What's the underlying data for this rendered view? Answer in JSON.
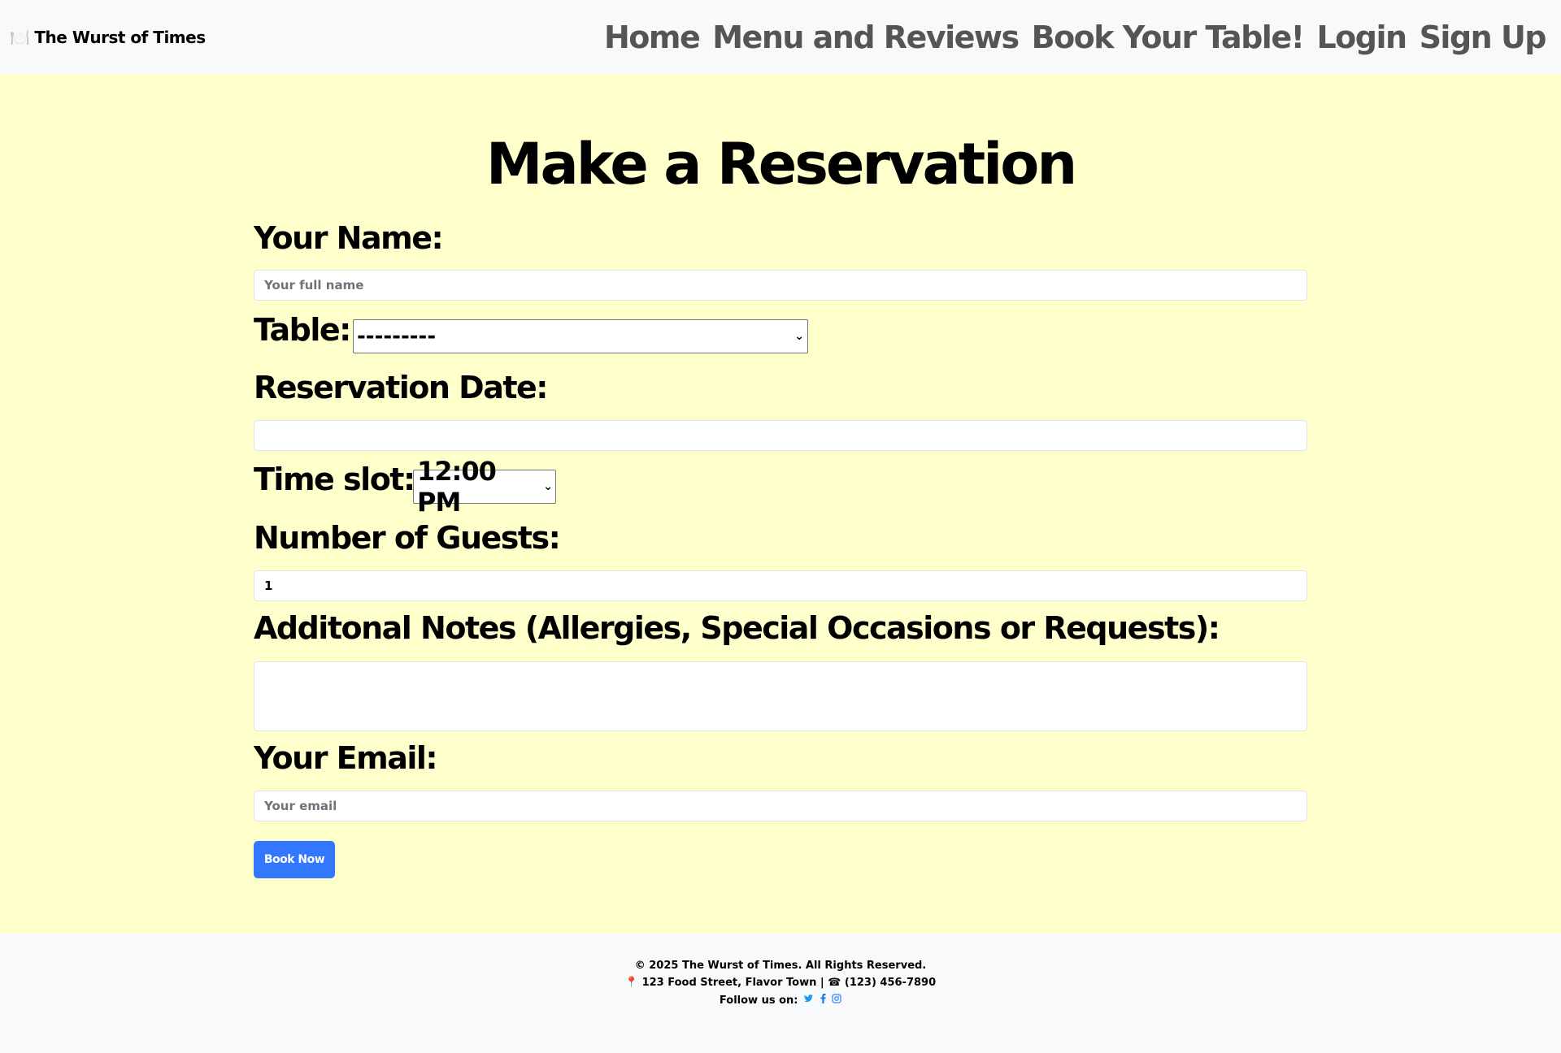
{
  "navbar": {
    "brand_icon": "🍽️",
    "brand": "The Wurst of Times",
    "links": [
      "Home",
      "Menu and Reviews",
      "Book Your Table!",
      "Login",
      "Sign Up"
    ]
  },
  "form": {
    "title": "Make a Reservation",
    "name_label": "Your Name:",
    "name_placeholder": "Your full name",
    "table_label": "Table:",
    "table_value": "---------",
    "date_label": "Reservation Date:",
    "time_label": "Time slot:",
    "time_value": "12:00 PM",
    "guests_label": "Number of Guests:",
    "guests_value": "1",
    "notes_label": "Additonal Notes (Allergies, Special Occasions or Requests):",
    "email_label": "Your Email:",
    "email_placeholder": "Your email",
    "submit": "Book Now"
  },
  "footer": {
    "copyright": "© 2025 The Wurst of Times. All Rights Reserved.",
    "pin_icon": "📍",
    "address": "123 Food Street, Flavor Town | ☎ (123) 456-7890",
    "follow": "Follow us on:",
    "social_icons": [
      "twitter-icon",
      "facebook-icon",
      "instagram-icon"
    ]
  },
  "colors": {
    "main_bg": "#ffffcc",
    "navbar_bg": "#f8f9fa",
    "button": "#3377ff",
    "nav_link": "#555555"
  }
}
